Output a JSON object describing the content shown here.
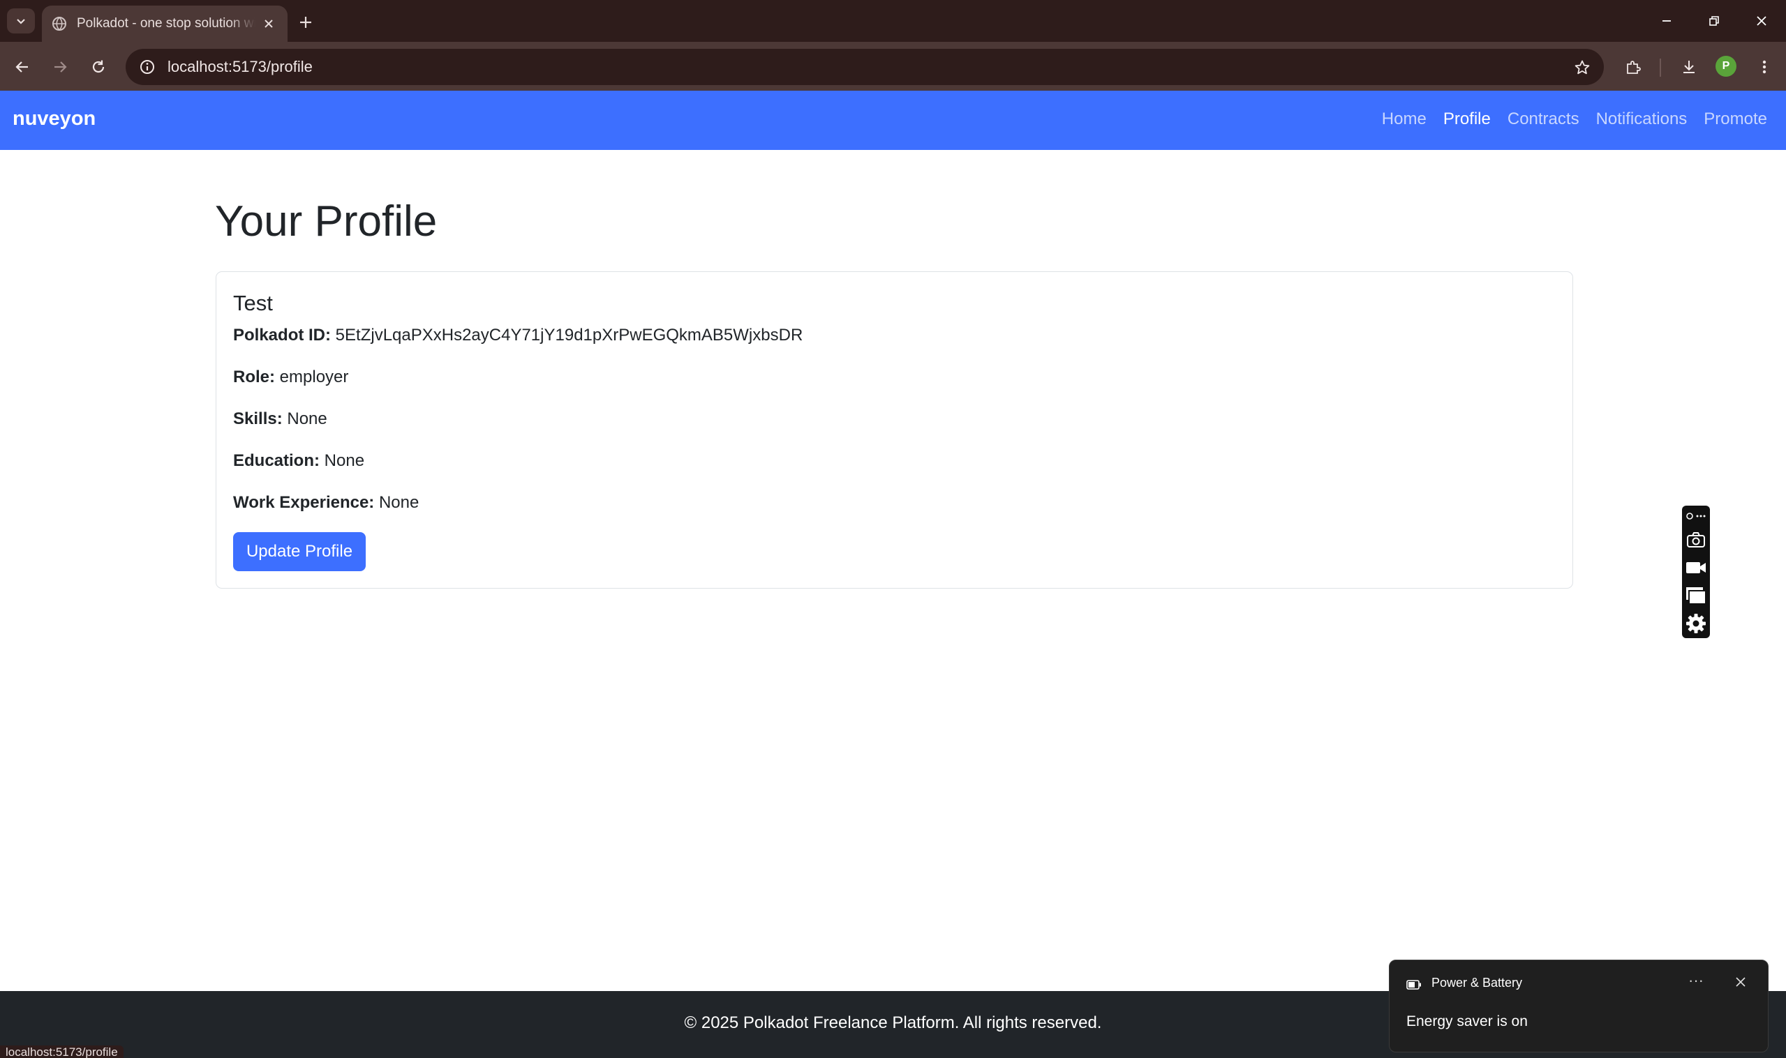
{
  "browser": {
    "tab_title": "Polkadot - one stop solution wi",
    "url": "localhost:5173/profile",
    "profile_initial": "P"
  },
  "app": {
    "brand": "nuveyon",
    "nav": [
      {
        "label": "Home",
        "active": false
      },
      {
        "label": "Profile",
        "active": true
      },
      {
        "label": "Contracts",
        "active": false
      },
      {
        "label": "Notifications",
        "active": false
      },
      {
        "label": "Promote",
        "active": false
      }
    ],
    "accent_color": "#3d6fff"
  },
  "profile": {
    "page_title": "Your Profile",
    "name": "Test",
    "fields": [
      {
        "label": "Polkadot ID:",
        "value": "5EtZjvLqaPXxHs2ayC4Y71jY19d1pXrPwEGQkmAB5WjxbsDR"
      },
      {
        "label": "Role:",
        "value": "employer"
      },
      {
        "label": "Skills:",
        "value": "None"
      },
      {
        "label": "Education:",
        "value": "None"
      },
      {
        "label": "Work Experience:",
        "value": "None"
      }
    ],
    "update_button": "Update Profile"
  },
  "footer": {
    "text": "© 2025 Polkadot Freelance Platform. All rights reserved."
  },
  "status_bar": {
    "hover_url": "localhost:5173/profile"
  },
  "toast": {
    "title": "Power & Battery",
    "body": "Energy saver is on",
    "more": "···"
  },
  "capture_widget": {
    "icons": [
      "pin-more-icon",
      "camera-icon",
      "video-icon",
      "window-icon",
      "gear-icon"
    ]
  }
}
